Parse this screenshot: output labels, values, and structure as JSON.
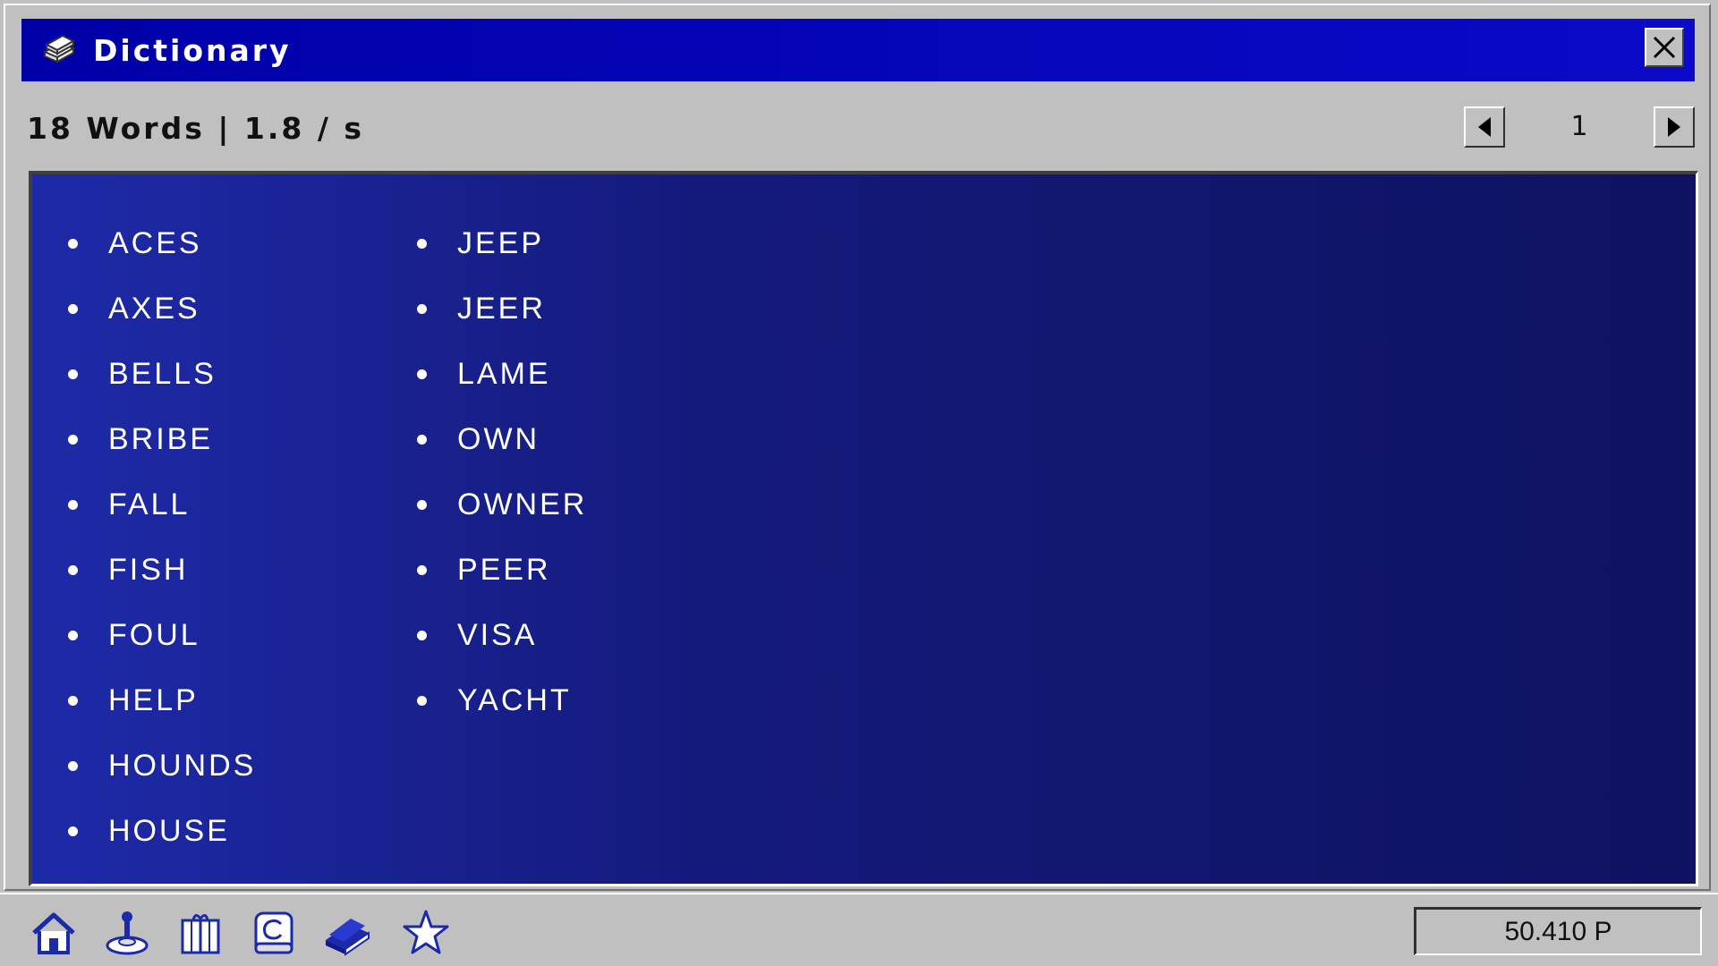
{
  "window": {
    "title": "Dictionary",
    "title_icon": "book-stack-icon",
    "close_icon": "close-icon"
  },
  "header": {
    "stats": "18 Words | 1.8 / s",
    "page": "1",
    "prev_icon": "arrow-left-icon",
    "next_icon": "arrow-right-icon"
  },
  "words": {
    "column1": [
      "ACES",
      "AXES",
      "BELLS",
      "BRIBE",
      "FALL",
      "FISH",
      "FOUL",
      "HELP",
      "HOUNDS",
      "HOUSE"
    ],
    "column2": [
      "JEEP",
      "JEER",
      "LAME",
      "OWN",
      "OWNER",
      "PEER",
      "VISA",
      "YACHT"
    ]
  },
  "taskbar": {
    "icons": [
      "home-icon",
      "joystick-icon",
      "gift-icon",
      "copyright-icon",
      "book-icon",
      "star-icon"
    ],
    "points": "50.410 P"
  },
  "colors": {
    "titlebar": "#0000a8",
    "panel_start": "#1e2aa8",
    "panel_end": "#0f1260",
    "chrome": "#c0c0c0"
  }
}
